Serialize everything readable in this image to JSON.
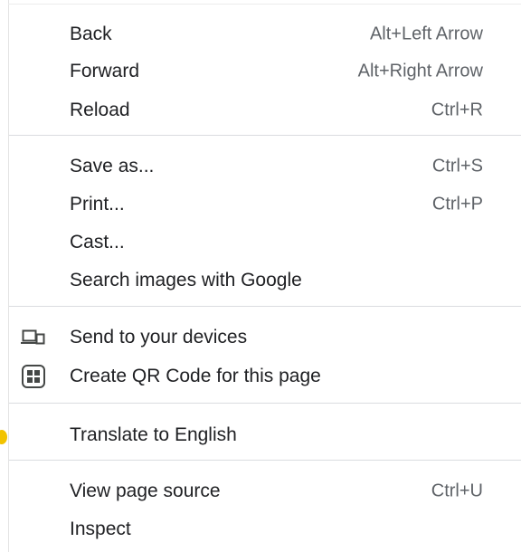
{
  "context_menu": {
    "items": [
      {
        "label": "Back",
        "shortcut": "Alt+Left Arrow"
      },
      {
        "label": "Forward",
        "shortcut": "Alt+Right Arrow"
      },
      {
        "label": "Reload",
        "shortcut": "Ctrl+R"
      },
      {
        "label": "Save as...",
        "shortcut": "Ctrl+S"
      },
      {
        "label": "Print...",
        "shortcut": "Ctrl+P"
      },
      {
        "label": "Cast..."
      },
      {
        "label": "Search images with Google"
      },
      {
        "label": "Send to your devices",
        "icon": "devices-icon"
      },
      {
        "label": "Create QR Code for this page",
        "icon": "qr-code-icon"
      },
      {
        "label": "Translate to English"
      },
      {
        "label": "View page source",
        "shortcut": "Ctrl+U"
      },
      {
        "label": "Inspect"
      }
    ]
  },
  "colors": {
    "text": "#202124",
    "shortcut_text": "#5f6368",
    "separator": "#dadce0",
    "indicator": "#f2c300"
  }
}
